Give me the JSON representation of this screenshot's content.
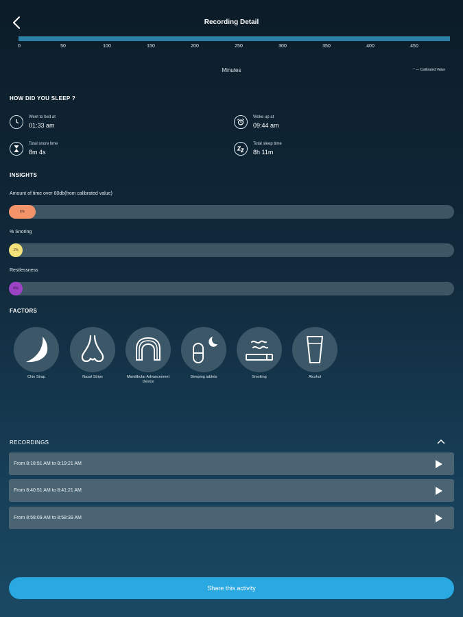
{
  "header": {
    "title": "Recording Detail"
  },
  "timeline": {
    "ticks": [
      "0",
      "50",
      "100",
      "150",
      "200",
      "250",
      "300",
      "350",
      "400",
      "450"
    ],
    "xlabel": "Minutes",
    "note": "* — Calibrated Value"
  },
  "sleep": {
    "heading": "HOW DID YOU SLEEP ?",
    "went_to_bed": {
      "label": "Went to bed at",
      "value": "01:33 am"
    },
    "woke_up": {
      "label": "Woke up at",
      "value": "09:44 am"
    },
    "total_snore": {
      "label": "Total snore time",
      "value": "8m 4s"
    },
    "total_sleep": {
      "label": "Total sleep time",
      "value": "8h 11m"
    }
  },
  "insights": {
    "heading": "INSIGHTS",
    "items": [
      {
        "label": "Amount of time over 80db(from calibrated value)",
        "pct_text": "6%",
        "fraction": 0.06,
        "color": "#f2936a"
      },
      {
        "label": "% Snoring",
        "pct_text": "1%",
        "fraction": 0.02,
        "color": "#f3e27a"
      },
      {
        "label": "Restlessness",
        "pct_text": "0%",
        "fraction": 0.015,
        "color": "#9b43c4"
      }
    ]
  },
  "factors": {
    "heading": "FACTORS",
    "items": [
      {
        "label": "Chin Strap",
        "icon": "chin-strap-icon"
      },
      {
        "label": "Nasal Strips",
        "icon": "nose-icon"
      },
      {
        "label": "Mandibular Advancement Device",
        "icon": "mouthguard-icon"
      },
      {
        "label": "Sleeping tablets",
        "icon": "pill-moon-icon"
      },
      {
        "label": "Smoking",
        "icon": "cigarette-icon"
      },
      {
        "label": "Alcohol",
        "icon": "glass-icon"
      }
    ]
  },
  "recordings": {
    "heading": "RECORDINGS",
    "items": [
      {
        "label": "From 8:18:51 AM to 8:19:21 AM"
      },
      {
        "label": "From 8:40:51 AM to 8:41:21 AM"
      },
      {
        "label": "From 8:58:09 AM to 8:58:39 AM"
      }
    ]
  },
  "share": {
    "label": "Share this activity"
  }
}
